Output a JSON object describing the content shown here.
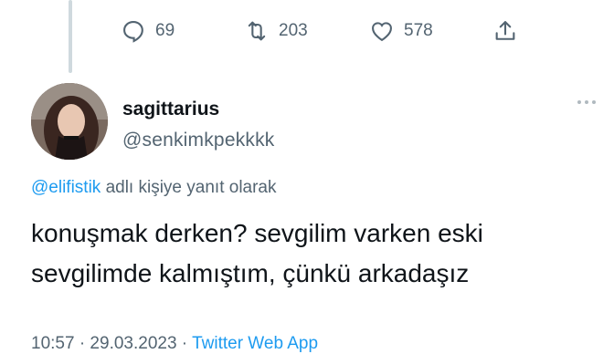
{
  "actions": {
    "reply_icon": "reply-icon",
    "reply_count": "69",
    "retweet_icon": "retweet-icon",
    "retweet_count": "203",
    "like_icon": "heart-icon",
    "like_count": "578",
    "share_icon": "share-icon"
  },
  "tweet": {
    "display_name": "sagittarius",
    "handle": "@senkimkpekkkk",
    "reply_mention": "@elifistik",
    "reply_suffix": " adlı kişiye yanıt olarak",
    "text_line_1": "konuşmak derken? sevgilim varken eski",
    "text_line_2": "sevgilimde kalmıştım, çünkü arkadaşız",
    "meta_time": "10:57 · 29.03.2023 · ",
    "meta_source": "Twitter Web App"
  },
  "colors": {
    "accent": "#1d9bf0",
    "secondary_text": "#536471",
    "primary_text": "#0f1419"
  }
}
